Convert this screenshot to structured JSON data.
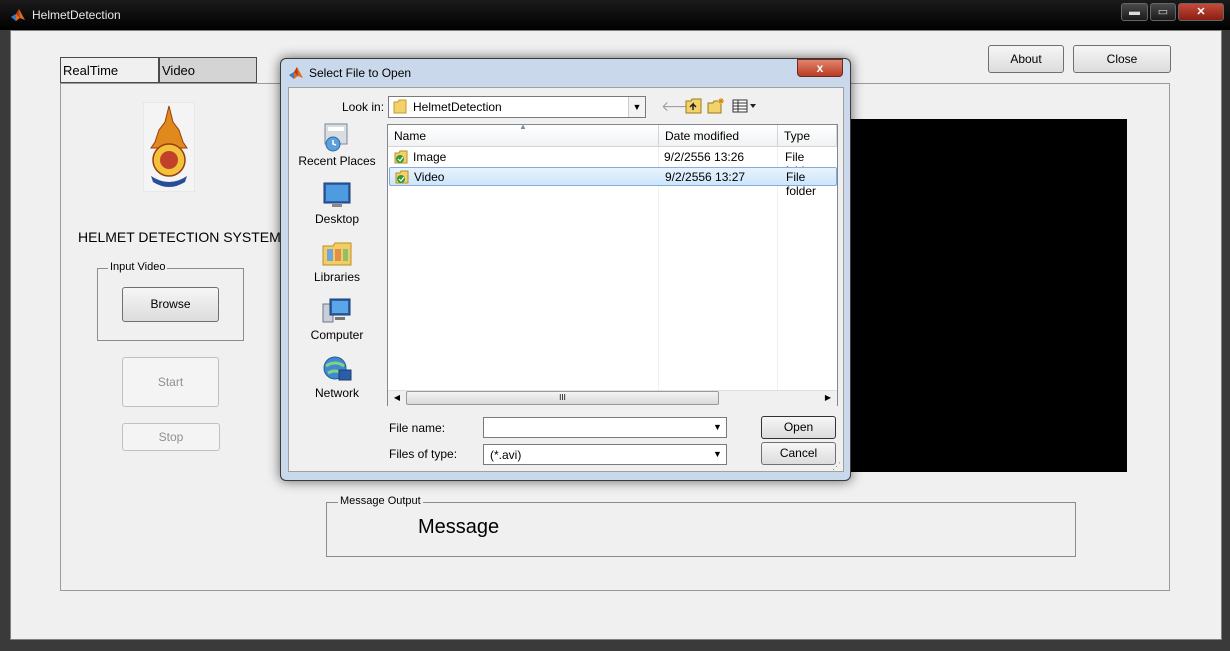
{
  "window": {
    "title": "HelmetDetection",
    "controls": {
      "minimize": "▬",
      "maximize": "▭",
      "close": "✕"
    },
    "icon": "matlab-logo-icon"
  },
  "tabs": [
    {
      "label": "RealTime"
    },
    {
      "label": "Video"
    }
  ],
  "left_panel": {
    "logo": "university-crest-logo",
    "title": "HELMET DETECTION SYSTEM",
    "input_group_label": "Input Video",
    "browse_label": "Browse",
    "start_label": "Start",
    "stop_label": "Stop"
  },
  "top_buttons": {
    "about_label": "About",
    "close_label": "Close"
  },
  "message": {
    "group_label": "Message Output",
    "text": "Message"
  },
  "dialog": {
    "title": "Select File to Open",
    "close_label": "x",
    "look_in_label": "Look in:",
    "look_in_value": "HelmetDetection",
    "toolbar_icons": [
      "back-arrow-icon",
      "up-folder-icon",
      "new-folder-icon",
      "view-menu-icon"
    ],
    "places": [
      {
        "label": "Recent Places",
        "icon": "recent-places-icon"
      },
      {
        "label": "Desktop",
        "icon": "desktop-icon"
      },
      {
        "label": "Libraries",
        "icon": "libraries-icon"
      },
      {
        "label": "Computer",
        "icon": "computer-icon"
      },
      {
        "label": "Network",
        "icon": "network-icon"
      }
    ],
    "columns": [
      "Name",
      "Date modified",
      "Type"
    ],
    "rows": [
      {
        "name": "Image",
        "date": "9/2/2556 13:26",
        "type": "File folder",
        "selected": false
      },
      {
        "name": "Video",
        "date": "9/2/2556 13:27",
        "type": "File folder",
        "selected": true
      }
    ],
    "scroll_thumb_glyph": "III",
    "file_name_label": "File name:",
    "file_name_value": "",
    "files_of_type_label": "Files of type:",
    "files_of_type_value": "(*.avi)",
    "open_label": "Open",
    "cancel_label": "Cancel"
  },
  "colors": {
    "video_display": "#000000",
    "selection": "#cde6fb",
    "dialog_frame": "#c9d8ea",
    "close_red": "#c44a3a"
  }
}
